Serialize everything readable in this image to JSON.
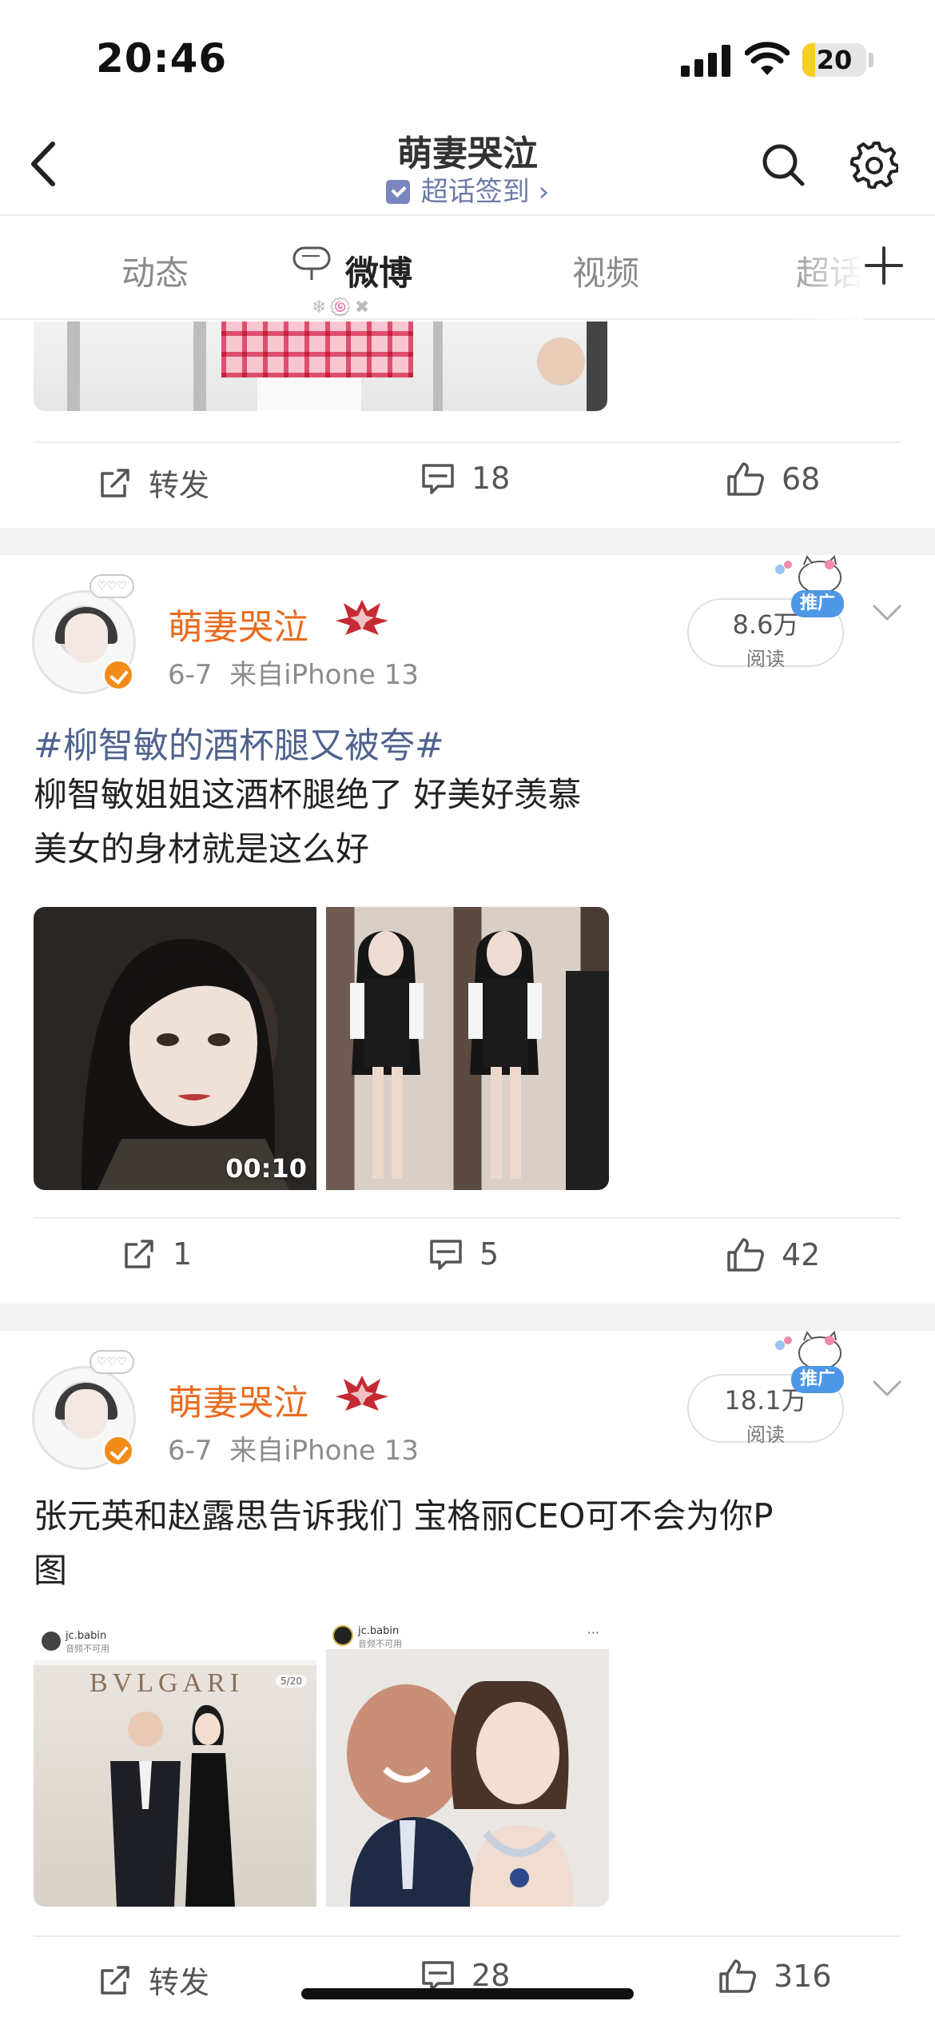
{
  "status_bar": {
    "time": "20:46",
    "battery": "20",
    "battery_fraction": 0.2
  },
  "header": {
    "title": "萌妻哭泣",
    "checkin": "超话签到",
    "checkin_chevron": "›"
  },
  "tabs": [
    {
      "label": "动态",
      "active": false
    },
    {
      "label": "微博",
      "active": true
    },
    {
      "label": "视频",
      "active": false
    },
    {
      "label": "超话",
      "active": false
    }
  ],
  "tab_dots": "❄🍥✖",
  "posts": [
    {
      "actions": {
        "repost": "转发",
        "comments": "18",
        "likes": "68"
      }
    },
    {
      "username": "萌妻哭泣",
      "date": "6-7",
      "source": "来自iPhone 13",
      "reads": "8.6万",
      "reads_label": "阅读",
      "promo": "推广",
      "topic": "#柳智敏的酒杯腿又被夸#",
      "text_lines": [
        "柳智敏姐姐这酒杯腿绝了 好美好羡慕",
        "美女的身材就是这么好"
      ],
      "video_duration": "00:10",
      "actions": {
        "repost": "1",
        "comments": "5",
        "likes": "42"
      }
    },
    {
      "username": "萌妻哭泣",
      "date": "6-7",
      "source": "来自iPhone 13",
      "reads": "18.1万",
      "reads_label": "阅读",
      "promo": "推广",
      "text_lines": [
        "张元英和赵露思告诉我们 宝格丽CEO可不会为你P",
        "图"
      ],
      "image_1": {
        "account": "jc.babin",
        "caption": "音频不可用",
        "brand": "BVLGARI",
        "counter": "5/20"
      },
      "image_2": {
        "account": "jc.babin",
        "caption": "音频不可用"
      },
      "actions": {
        "repost": "转发",
        "comments": "28",
        "likes": "316"
      }
    }
  ],
  "colors": {
    "username": "#e86b1f",
    "topic": "#50638e",
    "promo": "#4d97e6",
    "battery": "#f5d020"
  }
}
